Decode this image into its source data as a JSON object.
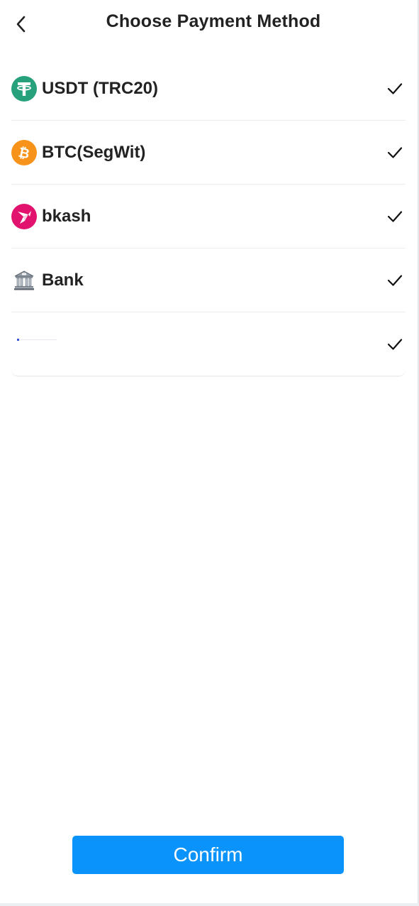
{
  "header": {
    "title": "Choose Payment Method",
    "back_icon": "chevron-left-icon"
  },
  "methods": [
    {
      "label": "USDT (TRC20)",
      "icon": "tether-icon",
      "icon_color": "#26a17b",
      "selected": true
    },
    {
      "label": "BTC(SegWit)",
      "icon": "bitcoin-icon",
      "icon_color": "#f7931a",
      "selected": true
    },
    {
      "label": "bkash",
      "icon": "bkash-icon",
      "icon_color": "#e2136e",
      "selected": true
    },
    {
      "label": "Bank",
      "icon": "bank-icon",
      "selected": true
    },
    {
      "label": "",
      "icon": "broken-image-icon",
      "selected": true
    }
  ],
  "footer": {
    "confirm_label": "Confirm"
  },
  "colors": {
    "accent": "#0a93fb",
    "text": "#222222",
    "divider": "#ececec"
  }
}
